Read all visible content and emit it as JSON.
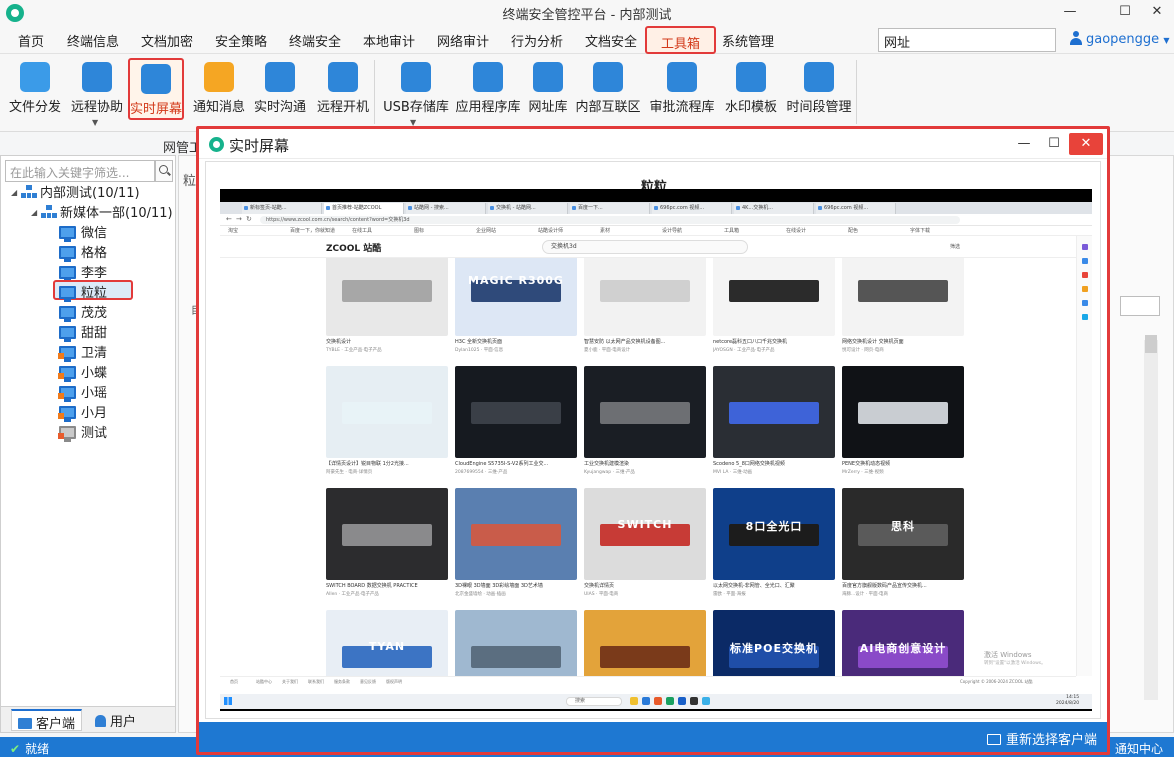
{
  "window": {
    "title": "终端安全管控平台 - 内部测试",
    "minimize": "—",
    "maximize": "☐",
    "close": "✕"
  },
  "menu": {
    "items": [
      "首页",
      "终端信息",
      "文档加密",
      "安全策略",
      "终端安全",
      "本地审计",
      "网络审计",
      "行为分析",
      "文档安全",
      "工具箱",
      "系统管理"
    ],
    "active_index": 9,
    "url_box": "网址",
    "user": "gaopengge"
  },
  "ribbon": {
    "tools": [
      {
        "label": "文件分发",
        "icon": "paper-plane-icon",
        "color": "#3b9be8"
      },
      {
        "label": "远程协助",
        "icon": "remote-assist-icon",
        "color": "#2e86d9"
      },
      {
        "label": "实时屏幕",
        "icon": "live-screen-icon",
        "color": "#2e86d9"
      },
      {
        "label": "通知消息",
        "icon": "bell-icon",
        "color": "#f5a623"
      },
      {
        "label": "实时沟通",
        "icon": "chat-bubble-icon",
        "color": "#2e86d9"
      },
      {
        "label": "远程开机",
        "icon": "remote-power-icon",
        "color": "#2e86d9"
      },
      {
        "label": "USB存储库",
        "icon": "usb-drive-icon",
        "color": "#2e86d9"
      },
      {
        "label": "应用程序库",
        "icon": "app-tools-icon",
        "color": "#2e86d9"
      },
      {
        "label": "网址库",
        "icon": "globe-icon",
        "color": "#2e86d9"
      },
      {
        "label": "内部互联区",
        "icon": "interconnect-icon",
        "color": "#2e86d9"
      },
      {
        "label": "审批流程库",
        "icon": "gear-icon",
        "color": "#2e86d9"
      },
      {
        "label": "水印模板",
        "icon": "watermark-grid-icon",
        "color": "#2e86d9"
      },
      {
        "label": "时间段管理",
        "icon": "clock-gear-icon",
        "color": "#2e86d9"
      }
    ],
    "selected_index": 2,
    "group_label": "网管工"
  },
  "tree": {
    "filter_placeholder": "在此输入关键字筛选...",
    "root": "内部测试(10/11)",
    "group": "新媒体一部(10/11)",
    "clients": [
      "微信",
      "格格",
      "李李",
      "粒粒",
      "茂茂",
      "甜甜",
      "卫清",
      "小蝶",
      "小瑶",
      "小月",
      "测试"
    ],
    "selected_client_index": 3
  },
  "left_tabs": {
    "client": "客户端",
    "user": "用户"
  },
  "background": {
    "frag_1": "粒",
    "frag_2": "目"
  },
  "status": {
    "text": "就绪",
    "notify": "通知中心"
  },
  "dialog": {
    "title": "实时屏幕",
    "client_name": "粒粒",
    "reselect_label": "重新选择客户端",
    "remote_screen": {
      "tabs": [
        "新标签页-站酷...",
        "首页推荐-站酷ZCOOL",
        "站酷网 - 搜索...",
        "交换机 - 站酷网...",
        "百度一下...",
        "696pc.com 视频...",
        "4K...交换机...",
        "696pc.com 视频..."
      ],
      "active_tab_index": 1,
      "url": "https://www.zcool.com.cn/search/content?word=交换机3d",
      "bookmarks": [
        "淘宝",
        "百度一下，你就知道",
        "在线工具",
        "图标",
        "企业网站",
        "站酷设计师",
        "素材",
        "设计导航",
        "工具箱",
        "在线设计",
        "配色",
        "字体下载"
      ],
      "site_logo": "ZCOOL 站酷",
      "search_text": "交换机3d",
      "filter_label": "筛选",
      "cards": [
        {
          "title": "交换机设计",
          "meta": "TYBLE · 工业产品·电子产品",
          "bg": "#e8e8e8",
          "device": "#a7a7a7",
          "text": ""
        },
        {
          "title": "H3C 全新交换机页面",
          "meta": "Dylan1025 · 平面·信息",
          "bg": "#dde7f5",
          "device": "#2f4a7a",
          "text": "MAGIC R300G"
        },
        {
          "title": "智慧安防 以太网产品交换机设备图...",
          "meta": "夏小鹿 · 平面·电商设计",
          "bg": "#f2f2f2",
          "device": "#d0d0d0",
          "text": ""
        },
        {
          "title": "netcore磊科五口八口千兆交换机",
          "meta": "JAYOSGN · 工业产品·电子产品",
          "bg": "#f4f4f4",
          "device": "#2b2b2b",
          "text": ""
        },
        {
          "title": "网络交换机设计 交换机页面",
          "meta": "悦可设计 · 网页·电商",
          "bg": "#f3f3f3",
          "device": "#555555",
          "text": ""
        },
        {
          "title": "【详情页设计】锐目物联 1分2光接...",
          "meta": "阿豪先生 · 电商·详情页",
          "bg": "#e6eef3",
          "device": "#e8f3f7",
          "text": ""
        },
        {
          "title": "CloudEngine S5735I-S-V2系列工业交...",
          "meta": "2087699554 · 三维·产品",
          "bg": "#161a20",
          "device": "#3a3f47",
          "text": ""
        },
        {
          "title": "工业交换机建模渲染",
          "meta": "Kyujangwap · 三维·产品",
          "bg": "#1a1e24",
          "device": "#6d6f73",
          "text": ""
        },
        {
          "title": "Scodeno 5_8口网络交换机视频",
          "meta": "MVI LA · 三维·动画",
          "bg": "#2a2e34",
          "device": "#3e63d8",
          "text": ""
        },
        {
          "title": "PENE交换机动态视频",
          "meta": "MrZerry · 三维·视频",
          "bg": "#101216",
          "device": "#c9cdd2",
          "text": ""
        },
        {
          "title": "SWITCH BOARD 数据交换机 PRACTICE",
          "meta": "Allen · 工业产品·电子产品",
          "bg": "#2c2c2e",
          "device": "#8a8a8c",
          "text": ""
        },
        {
          "title": "3D裸眼 3D墙面 3D彩绘墙面 3D艺术墙",
          "meta": "北京金盛墙绘 · 动画·插画",
          "bg": "#5a7fb0",
          "device": "#c95c4a",
          "text": ""
        },
        {
          "title": "交换机详情页",
          "meta": "UIAS · 平面·电商",
          "bg": "#dcdcdc",
          "device": "#c73b36",
          "text": "SWITCH"
        },
        {
          "title": "以太网交换机-非网管、全光口、汇聚",
          "meta": "雷欧 · 平面·海报",
          "bg": "#0f3f8a",
          "device": "#1c1c1c",
          "text": "8口全光口"
        },
        {
          "title": "百度官方旗舰版数码产品宣传交换机...",
          "meta": "海豚...设计 · 平面·电商",
          "bg": "#2a2a2a",
          "device": "#5a5a5a",
          "text": "思科"
        },
        {
          "title": "TYAN 服务器 交换机产品包装",
          "meta": "TYAN · 平面·包装",
          "bg": "#e8eef5",
          "device": "#3c74c4",
          "text": "TYAN"
        },
        {
          "title": "3D地贴 街头裸眼3D",
          "meta": "设计 · 插画",
          "bg": "#9fb8d0",
          "device": "#5b6e80",
          "text": ""
        },
        {
          "title": "国潮插画 狮子",
          "meta": "插画师 · 插画",
          "bg": "#e3a33a",
          "device": "#7a3a1a",
          "text": ""
        },
        {
          "title": "标准POE交换机",
          "meta": "Hi-Fiber · 平面·电商",
          "bg": "#0b2a66",
          "device": "#1f4ea8",
          "text": "标准POE交换机"
        },
        {
          "title": "AI电商创意设计大赛",
          "meta": "ZCOOL · 赛事",
          "bg": "#4a2a7a",
          "device": "#8a4ac8",
          "text": "AI电商创意设计"
        }
      ],
      "footer_links": [
        "首页",
        "站酷中心",
        "关于我们",
        "联系我们",
        "服务条款",
        "意见反馈",
        "版权声明"
      ],
      "footer_right": "Copyright © 2006-2024 ZCOOL 站酷",
      "activate_windows": "激活 Windows",
      "activate_windows_hint": "转到\"设置\"以激活 Windows。",
      "taskbar_search": "搜索",
      "clock_time": "14:15",
      "clock_date": "2024/8/20"
    }
  }
}
